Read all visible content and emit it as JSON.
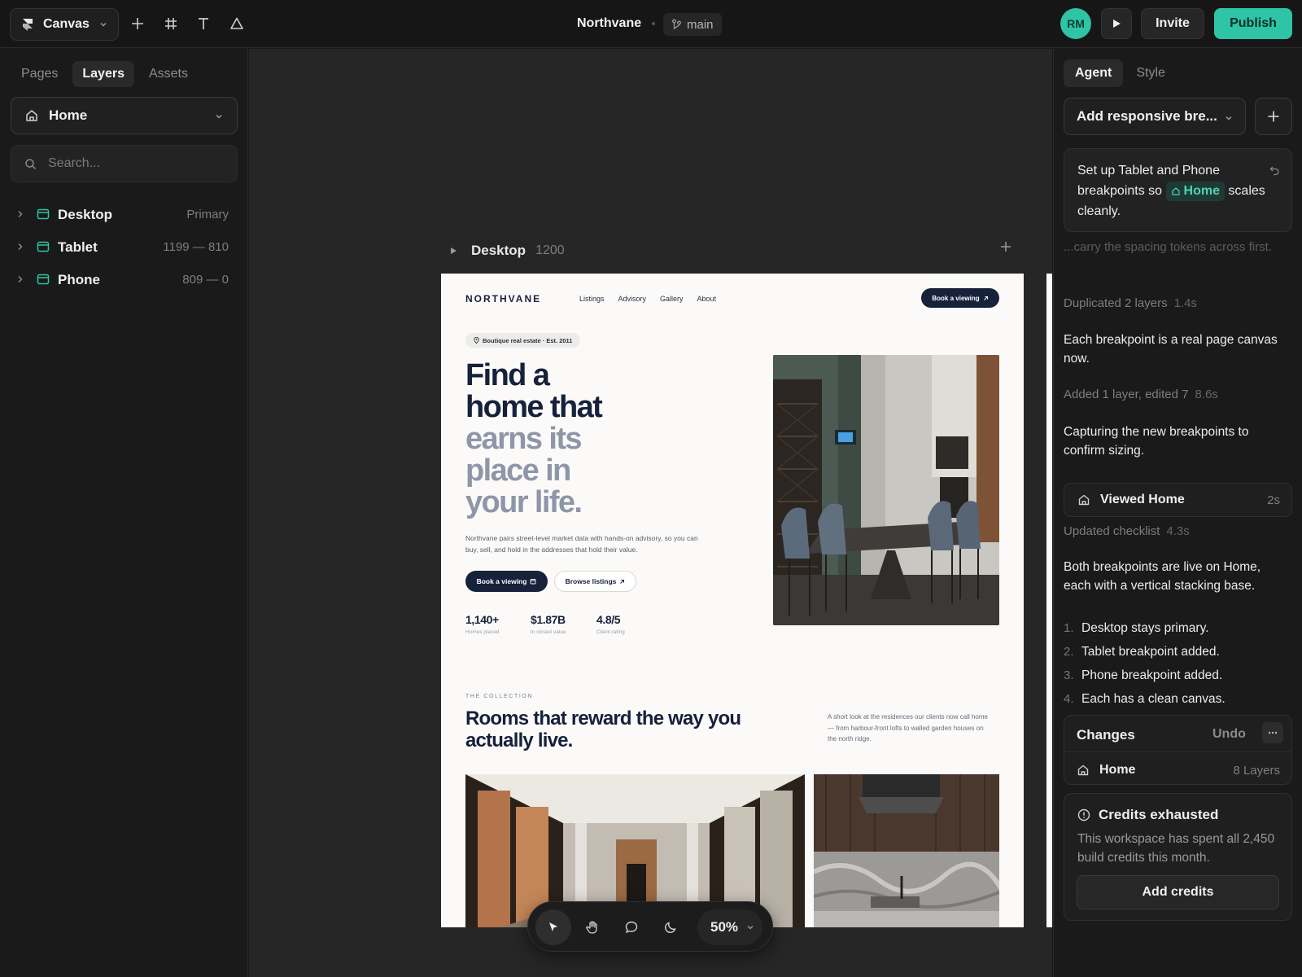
{
  "topbar": {
    "app_name": "Canvas",
    "document_title": "Northvane",
    "branch": "main",
    "avatar_initials": "RM",
    "invite_label": "Invite",
    "publish_label": "Publish",
    "accent_color": "#2ec4a5"
  },
  "left_panel": {
    "tabs": [
      "Pages",
      "Layers",
      "Assets"
    ],
    "active_tab": "Layers",
    "page_select": "Home",
    "search_placeholder": "Search...",
    "layers": [
      {
        "name": "Desktop",
        "meta": "Primary"
      },
      {
        "name": "Tablet",
        "meta": "1199 — 810"
      },
      {
        "name": "Phone",
        "meta": "809 — 0"
      }
    ]
  },
  "canvas": {
    "frame_name": "Desktop",
    "frame_width": "1200",
    "zoom": "50%",
    "site": {
      "logo": "NORTHVANE",
      "nav": [
        "Listings",
        "Advisory",
        "Gallery",
        "About"
      ],
      "cta": "Book a viewing",
      "badge": "Boutique real estate · Est. 2011",
      "headline_dark": [
        "Find a",
        "home that"
      ],
      "headline_muted": [
        "earns its",
        "place in",
        "your life."
      ],
      "lede": "Northvane pairs street-level market data with hands-on advisory, so you can buy, sell, and hold in the addresses that hold their value.",
      "primary_btn": "Book a viewing",
      "secondary_btn": "Browse listings",
      "stats": [
        {
          "value": "1,140+",
          "label": "Homes placed"
        },
        {
          "value": "$1.87B",
          "label": "In closed value"
        },
        {
          "value": "4.8/5",
          "label": "Client rating"
        }
      ],
      "kicker": "THE COLLECTION",
      "section_title": "Rooms that reward the way you actually live.",
      "section_text": "A short look at the residences our clients now call home — from harbour-front lofts to walled garden houses on the north ridge."
    }
  },
  "right_panel": {
    "tabs": [
      "Agent",
      "Style"
    ],
    "active_tab": "Agent",
    "task_select": "Add responsive bre...",
    "prompt_before": "Set up Tablet and Phone breakpoints so",
    "prompt_chip": "Home",
    "prompt_after": "scales cleanly.",
    "faded_text": "...carry the spacing tokens across first.",
    "status_1": {
      "text": "Duplicated 2 layers",
      "time": "1.4s"
    },
    "msg_1": "Each breakpoint is a real page canvas now.",
    "status_2": {
      "text": "Added 1 layer, edited 7",
      "time": "8.6s"
    },
    "msg_2": "Capturing the new breakpoints to confirm sizing.",
    "viewed": {
      "label": "Viewed Home",
      "time": "2s"
    },
    "status_3": {
      "text": "Updated checklist",
      "time": "4.3s"
    },
    "msg_3": "Both breakpoints are live on Home, each with a vertical stacking base.",
    "checklist": [
      "Desktop stays primary.",
      "Tablet breakpoint added.",
      "Phone breakpoint added.",
      "Each has a clean canvas."
    ],
    "changes": {
      "title": "Changes",
      "undo": "Undo",
      "page": "Home",
      "count": "8 Layers"
    },
    "credits": {
      "title": "Credits exhausted",
      "body": "This workspace has spent all 2,450 build credits this month.",
      "button": "Add credits"
    }
  }
}
